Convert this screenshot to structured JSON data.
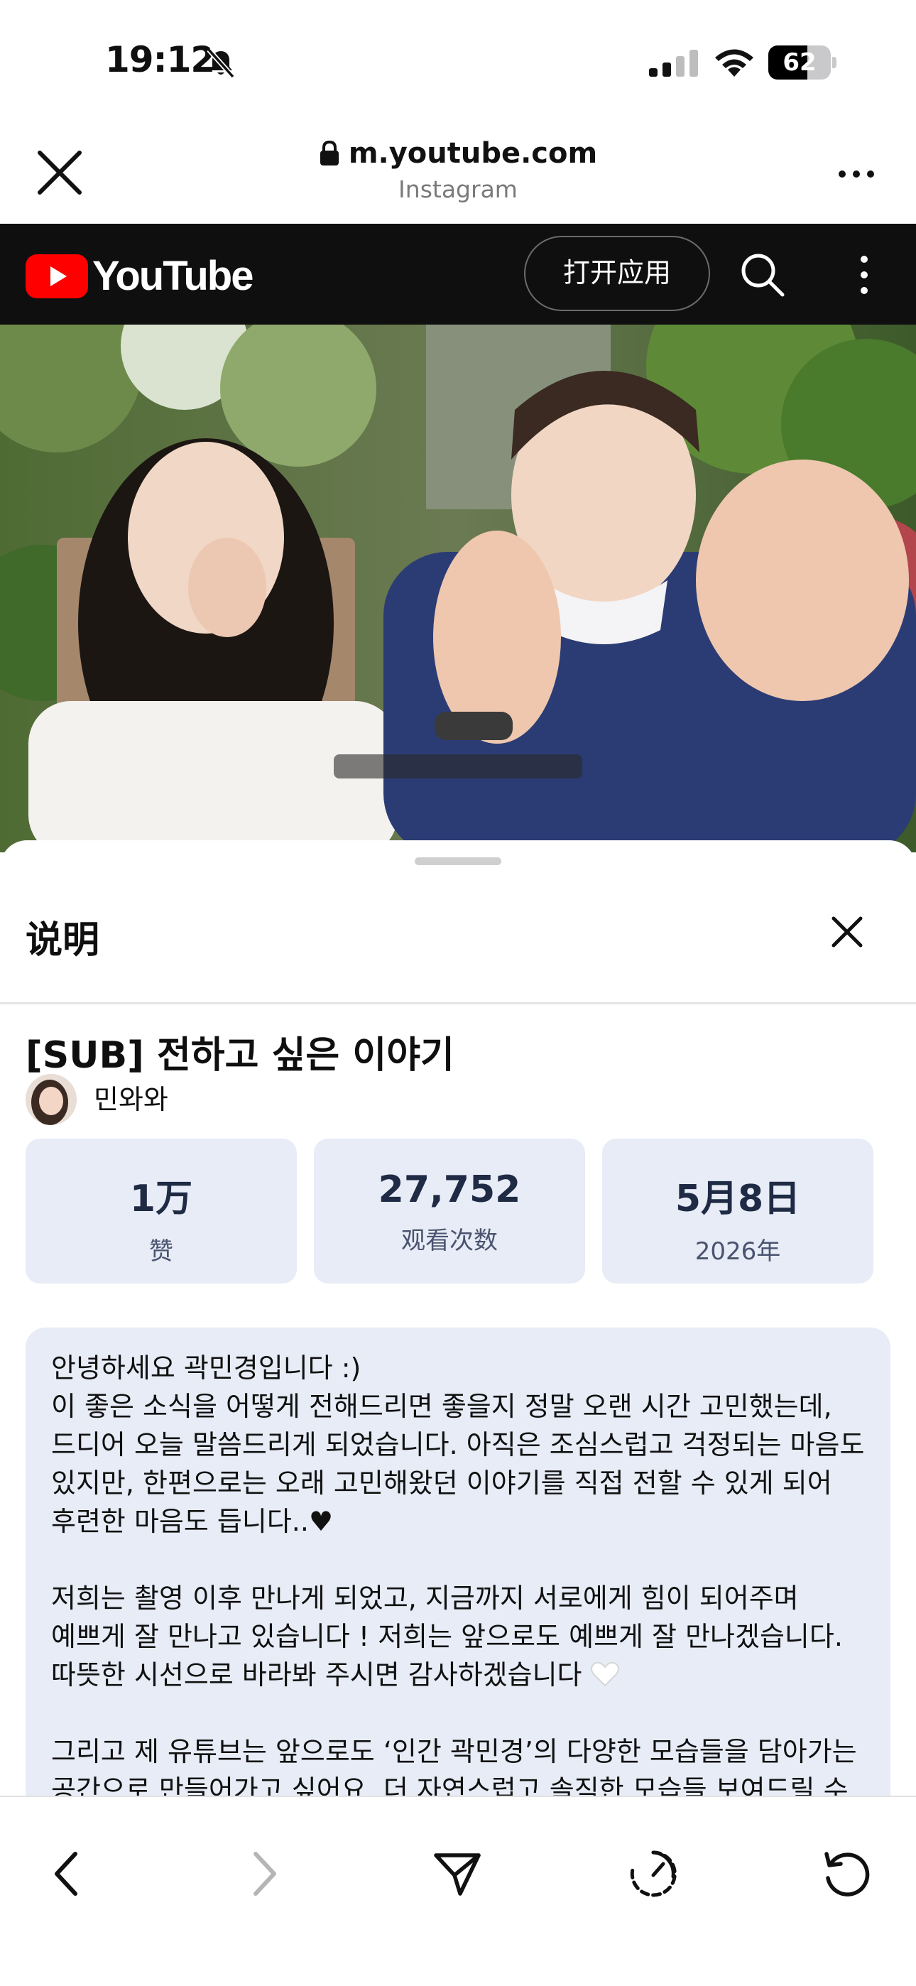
{
  "status_bar": {
    "time": "19:12",
    "battery_percent": "62",
    "battery_level": 0.62
  },
  "browser": {
    "url": "m.youtube.com",
    "source": "Instagram"
  },
  "youtube_bar": {
    "logo_text": "YouTube",
    "open_app_label": "打开应用"
  },
  "sheet": {
    "title": "说明",
    "video_title": "[SUB] 전하고 싶은 이야기",
    "channel_name": "민와와",
    "stats": {
      "likes_value": "1万",
      "likes_label": "赞",
      "views_value": "27,752",
      "views_label": "观看次数",
      "date_value": "5月8日",
      "date_year": "2026年"
    },
    "description": {
      "p1": "안녕하세요 곽민경입니다 :)\n이 좋은 소식을 어떻게 전해드리면 좋을지 정말 오랜 시간 고민했는데, 드디어 오늘 말씀드리게 되었습니다. 아직은 조심스럽고 걱정되는 마음도 있지만, 한편으로는 오래 고민해왔던 이야기를 직접 전할 수 있게 되어 후련한 마음도 듭니다..♥",
      "p2": "저희는 촬영 이후 만나게 되었고, 지금까지 서로에게 힘이 되어주며 예쁘게 잘 만나고 있습니다 ! 저희는 앞으로도 예쁘게 잘 만나겠습니다. 따뜻한 시선으로 바라봐 주시면 감사하겠습니다",
      "p3": "그리고 제 유튜브는 앞으로도 ‘인간 곽민경’의 다양한 모습들을 담아가는 공간으로 만들어가고 싶어요. 더 자연스럽고 솔직한 모습들 보여드릴 수 있도록 노력하겠습니다. 앞으로도 잘 부탁드립니다 :)"
    }
  },
  "colors": {
    "youtube_red": "#ff0000",
    "yt_bar_bg": "#0f0f0f",
    "stat_card_bg": "#e7ecf6"
  },
  "icons": [
    "bell-slash-icon",
    "signal-icon",
    "wifi-icon",
    "battery-icon",
    "close-icon",
    "lock-icon",
    "more-horizontal-icon",
    "youtube-play-icon",
    "search-icon",
    "more-vertical-icon",
    "white-heart-icon",
    "chevron-left-icon",
    "chevron-right-icon",
    "share-icon",
    "timer-icon",
    "reload-icon"
  ]
}
